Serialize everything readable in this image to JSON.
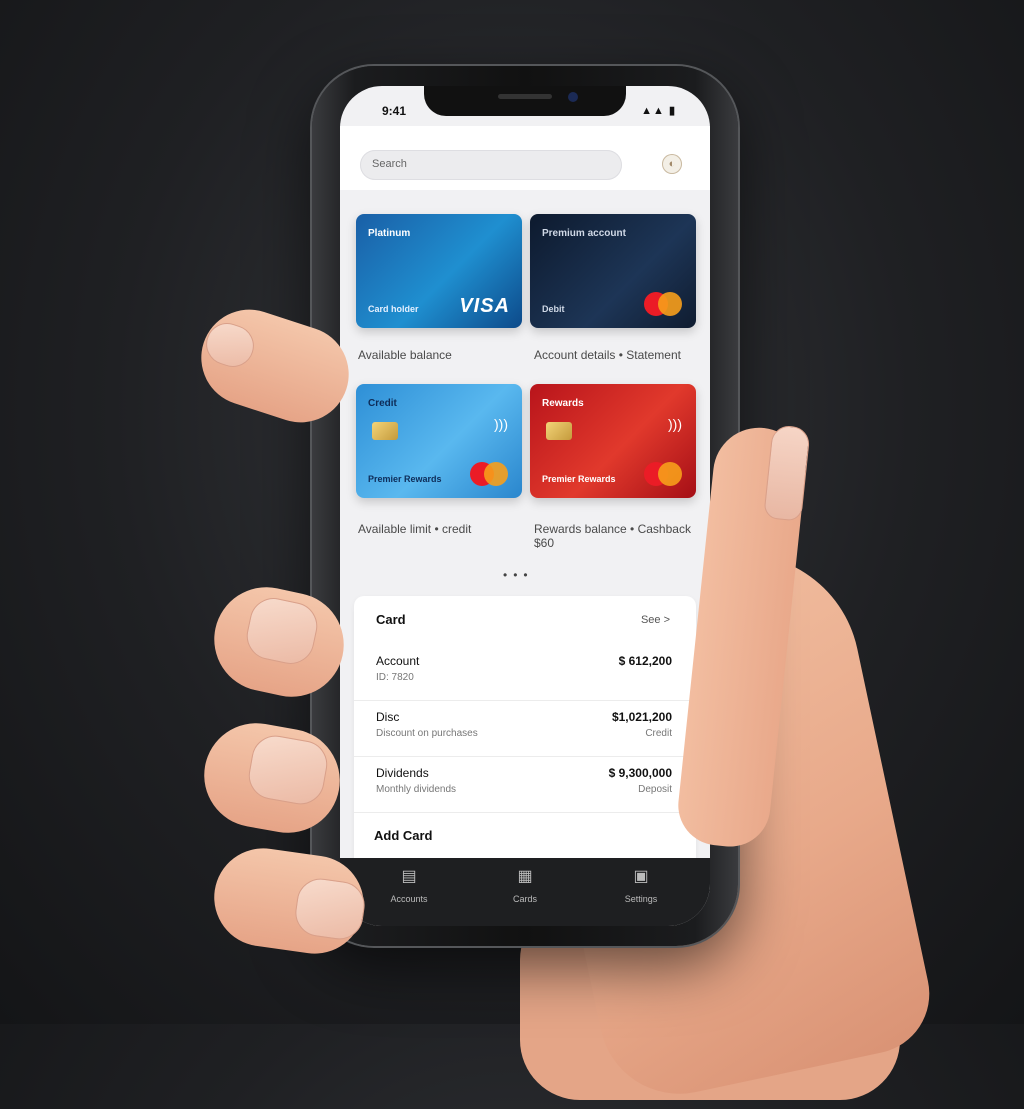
{
  "status": {
    "time": "9:41",
    "signal": "▲▲ ▮"
  },
  "search": {
    "placeholder": "Search"
  },
  "cards": [
    {
      "title": "Platinum",
      "bottom": "Card holder",
      "brand": "VISA",
      "label": "Available balance"
    },
    {
      "title": "Premium account",
      "bottom": "Debit",
      "brand": "mastercard",
      "label": "Account details • Statement"
    },
    {
      "title": "Credit",
      "bottom": "Premier Rewards",
      "brand": "mastercard",
      "label": "Available limit • credit"
    },
    {
      "title": "Rewards",
      "bottom": "Premier Rewards",
      "brand": "mastercard",
      "label": "Rewards balance • Cashback $60"
    }
  ],
  "list": {
    "title": "Card",
    "see_all": "See >",
    "rows": [
      {
        "name": "Account",
        "sub": "ID: 7820",
        "value": "$ 612,200",
        "value_sub": ""
      },
      {
        "name": "Disc",
        "sub": "Discount on purchases",
        "value": "$1,021,200",
        "value_sub": "Credit"
      },
      {
        "name": "Dividends",
        "sub": "Monthly dividends",
        "value": "$ 9,300,000",
        "value_sub": "Deposit"
      }
    ],
    "subheading": "Add Card"
  },
  "tabs": [
    {
      "label": "Accounts",
      "icon": "wallet-icon"
    },
    {
      "label": "Cards",
      "icon": "card-icon"
    },
    {
      "label": "Settings",
      "icon": "settings-icon"
    }
  ],
  "colors": {
    "card_blue": "#1c6fb5",
    "card_navy": "#0f1d34",
    "card_sky": "#3aa6e2",
    "card_red": "#d2232a"
  }
}
